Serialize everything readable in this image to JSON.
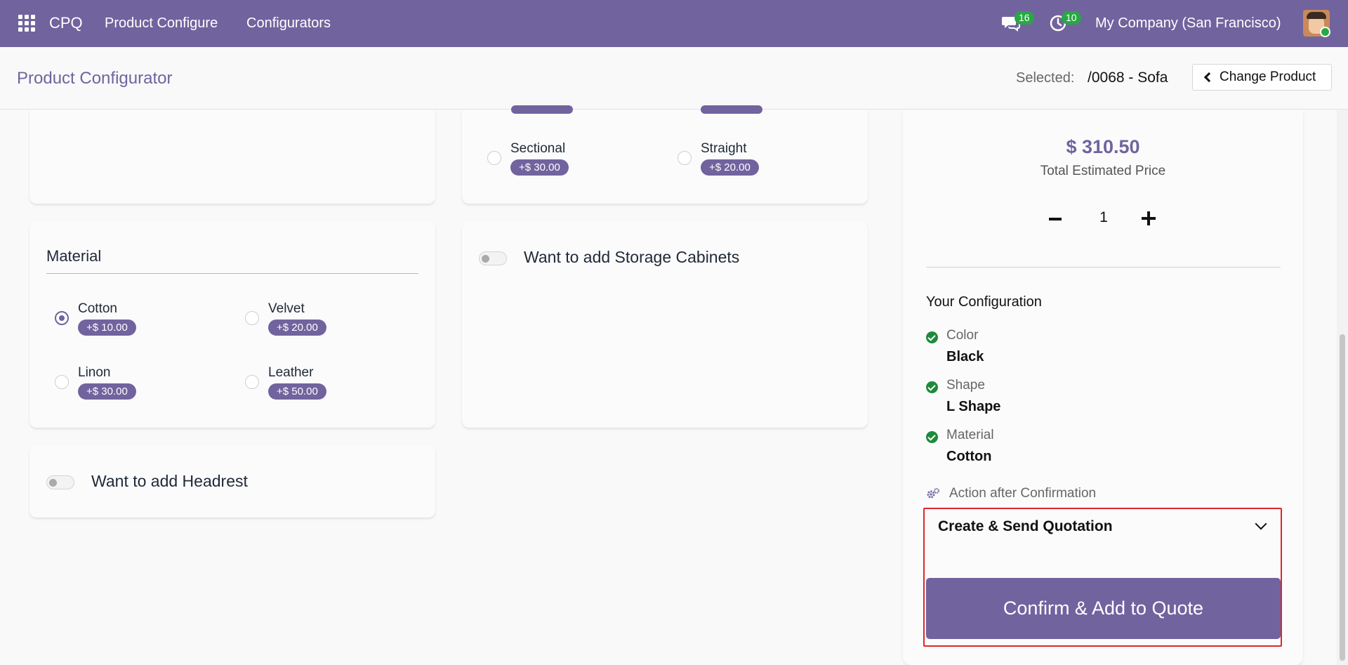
{
  "topbar": {
    "brand": "CPQ",
    "nav": [
      "Product Configure",
      "Configurators"
    ],
    "messages_badge": "16",
    "activities_badge": "10",
    "company": "My Company (San Francisco)"
  },
  "header": {
    "title": "Product Configurator",
    "selected_label": "Selected:",
    "selected_value": "/0068 - Sofa",
    "change_product_label": "Change Product"
  },
  "shape": {
    "options": [
      {
        "label": "Sectional",
        "price": "+$ 30.00",
        "checked": false
      },
      {
        "label": "Straight",
        "price": "+$ 20.00",
        "checked": false
      }
    ]
  },
  "material": {
    "title": "Material",
    "options": [
      {
        "label": "Cotton",
        "price": "+$ 10.00",
        "checked": true
      },
      {
        "label": "Velvet",
        "price": "+$ 20.00",
        "checked": false
      },
      {
        "label": "Linon",
        "price": "+$ 30.00",
        "checked": false
      },
      {
        "label": "Leather",
        "price": "+$ 50.00",
        "checked": false
      }
    ]
  },
  "toggles": {
    "storage": "Want to add Storage Cabinets",
    "headrest": "Want to add Headrest"
  },
  "summary": {
    "total_price": "$ 310.50",
    "total_label": "Total Estimated Price",
    "quantity": "1",
    "config_title": "Your Configuration",
    "items": [
      {
        "key": "Color",
        "value": "Black"
      },
      {
        "key": "Shape",
        "value": "L Shape"
      },
      {
        "key": "Material",
        "value": "Cotton"
      }
    ],
    "action_label": "Action after Confirmation",
    "action_value": "Create & Send Quotation",
    "confirm_label": "Confirm & Add to Quote"
  },
  "colors": {
    "accent": "#71639e",
    "success": "#28a745",
    "highlight": "#e0262b"
  }
}
